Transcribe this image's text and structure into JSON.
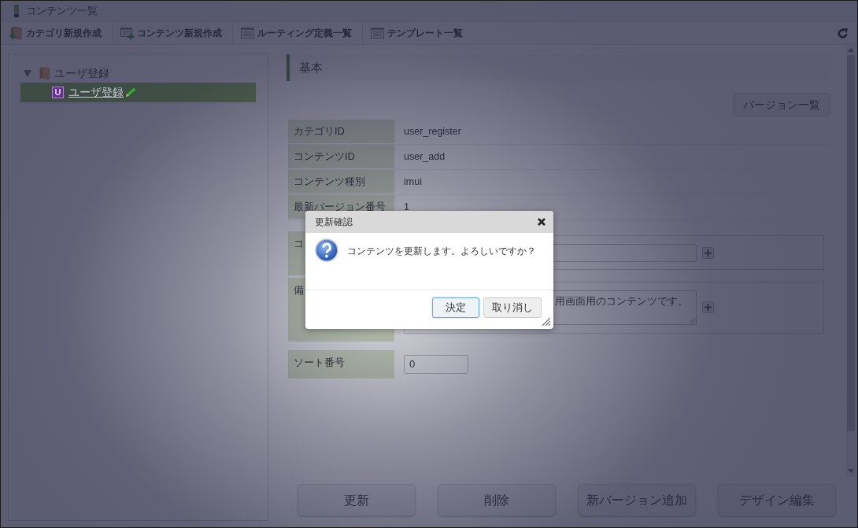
{
  "window": {
    "title": "コンテンツ一覧"
  },
  "toolbar": {
    "items": [
      {
        "label": "カテゴリ新規作成",
        "kind": "add-folder"
      },
      {
        "label": "コンテンツ新規作成",
        "kind": "add-card"
      },
      {
        "label": "ルーティング定義一覧",
        "kind": "list"
      },
      {
        "label": "テンプレート一覧",
        "kind": "list"
      }
    ]
  },
  "tree": [
    {
      "label": "ユーザ登録",
      "expanded": true,
      "selected": false,
      "children": [
        {
          "label": "ユーザ登録",
          "badge": "U",
          "selected": true
        }
      ]
    }
  ],
  "section": {
    "title": "基本"
  },
  "version_button": "バージョン一覧",
  "details": [
    {
      "label": "カテゴリID",
      "value": "user_register"
    },
    {
      "label": "コンテンツID",
      "value": "user_add"
    },
    {
      "label": "コンテンツ種別",
      "value": "imui"
    },
    {
      "label": "最新バージョン番号",
      "value": "1"
    }
  ],
  "form": [
    {
      "kind": "input",
      "label": "コ"
    },
    {
      "kind": "textarea",
      "label": "備",
      "value": "用画面用のコンテンツです。"
    },
    {
      "kind": "number",
      "label": "ソート番号",
      "value": "0"
    }
  ],
  "actions": [
    "更新",
    "削除",
    "新バージョン追加",
    "デザイン編集"
  ],
  "dialog": {
    "title": "更新確認",
    "message": "コンテンツを更新します。よろしいですか？",
    "buttons": [
      {
        "label": "決定",
        "focused": true
      },
      {
        "label": "取り消し",
        "focused": false
      }
    ]
  }
}
